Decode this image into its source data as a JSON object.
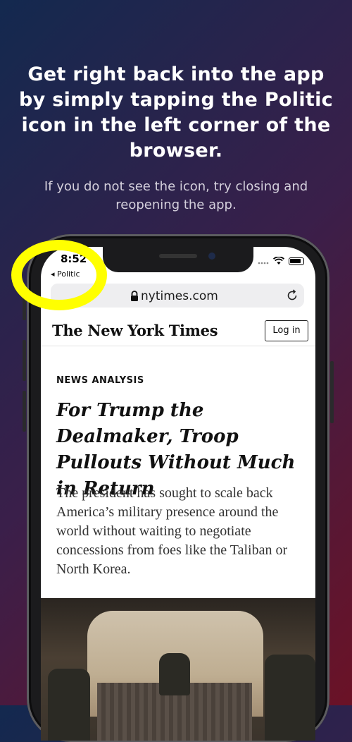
{
  "promo": {
    "headline": "Get right back into the app by simply tapping the Politic icon in the left corner of the browser.",
    "subline": "If you do not see the icon, try closing and reopening the app."
  },
  "status_bar": {
    "time": "8:52",
    "back_label": "◂ Politic"
  },
  "browser": {
    "url": "nytimes.com"
  },
  "article": {
    "site_name": "The New York Times",
    "login_label": "Log in",
    "kicker": "NEWS ANALYSIS",
    "title": "For Trump the Dealmaker, Troop Pullouts Without Much in Return",
    "summary": "The president has sought to scale back America’s military presence around the world without waiting to negotiate concessions from foes like the Taliban or North Korea."
  },
  "colors": {
    "highlight": "#ffff00",
    "bg_left": "#13294f",
    "bg_right": "#6b1226"
  },
  "icons": [
    "lock-icon",
    "reload-icon",
    "wifi-icon",
    "battery-icon",
    "signal-icon",
    "back-arrow-icon"
  ]
}
